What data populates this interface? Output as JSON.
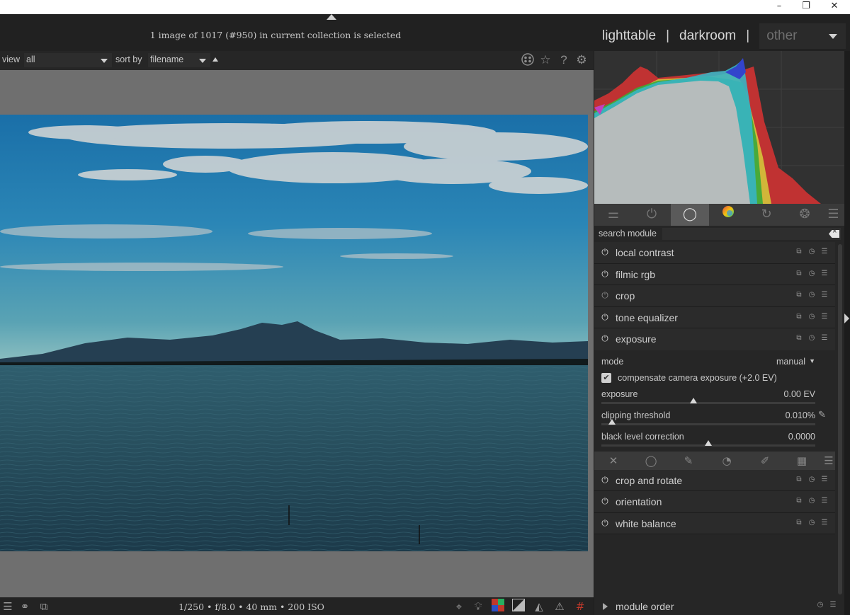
{
  "window": {
    "minimize": "–",
    "restore": "❐",
    "close": "✕"
  },
  "header": {
    "info": "1 image of 1017 (#950) in current collection is selected",
    "views": {
      "lighttable": "lighttable",
      "sep1": "|",
      "darkroom": "darkroom",
      "sep2": "|",
      "other": "other"
    }
  },
  "filterbar": {
    "view_label": "view",
    "view_value": "all",
    "sort_label": "sort by",
    "sort_value": "filename"
  },
  "bottombar": {
    "info": "1/250 • f/8.0 • 40 mm • 200 ISO"
  },
  "search": {
    "label": "search module",
    "placeholder": ""
  },
  "modules": [
    {
      "name": "local contrast",
      "enabled": true
    },
    {
      "name": "filmic rgb",
      "enabled": true
    },
    {
      "name": "crop",
      "enabled": false
    },
    {
      "name": "tone equalizer",
      "enabled": true
    },
    {
      "name": "exposure",
      "enabled": true,
      "expanded": true
    }
  ],
  "exposure_module": {
    "mode_label": "mode",
    "mode_value": "manual",
    "compensate_label": "compensate camera exposure (+2.0 EV)",
    "compensate_checked": true,
    "exposure_label": "exposure",
    "exposure_value": "0.00 EV",
    "exposure_position": 0.43,
    "clipping_label": "clipping threshold",
    "clipping_value": "0.010%",
    "clipping_position": 0.05,
    "black_label": "black level correction",
    "black_value": "0.0000",
    "black_position": 0.5
  },
  "modules_after": [
    {
      "name": "crop and rotate",
      "enabled": true
    },
    {
      "name": "orientation",
      "enabled": true
    },
    {
      "name": "white balance",
      "enabled": true
    }
  ],
  "module_order": {
    "label": "module order"
  },
  "colors": {
    "background": "#1f1f1f",
    "panel": "#262626",
    "center": "#6f6f6f",
    "text": "#cfcfcf"
  }
}
